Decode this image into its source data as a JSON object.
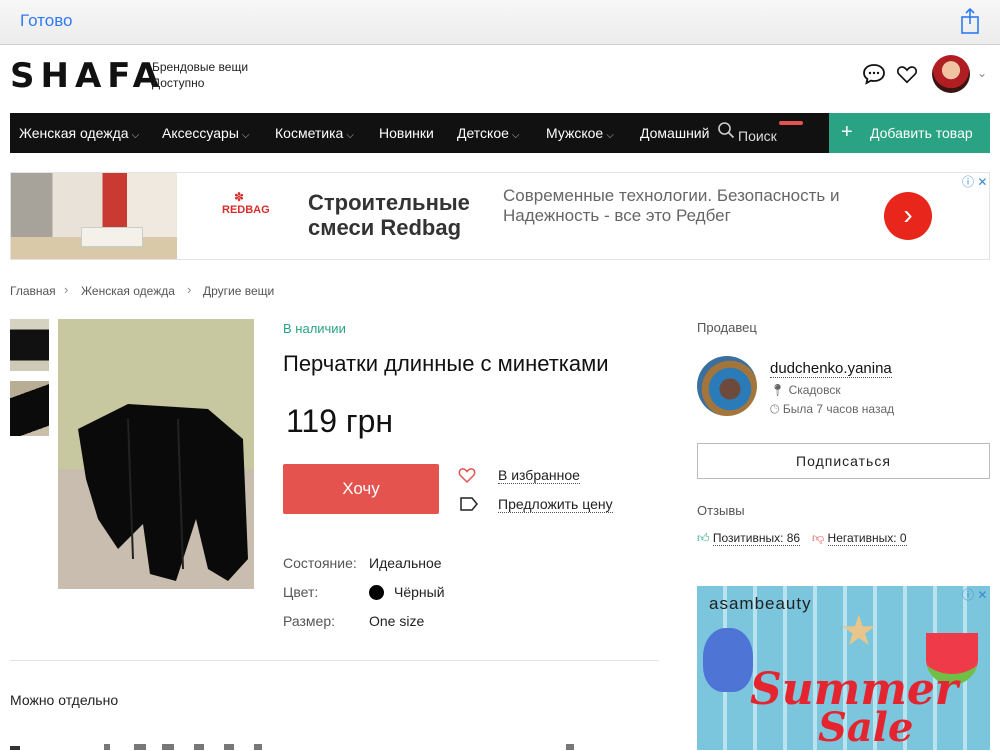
{
  "browser": {
    "done_label": "Готово"
  },
  "header": {
    "logo": "SHAFA",
    "tagline_1": "Брендовые вещи",
    "tagline_2": "Доступно"
  },
  "nav": {
    "items": [
      {
        "label": "Женская одежда",
        "chevron": true
      },
      {
        "label": "Аксессуары",
        "chevron": true
      },
      {
        "label": "Косметика",
        "chevron": true
      },
      {
        "label": "Новинки",
        "chevron": false
      },
      {
        "label": "Детское",
        "chevron": true
      },
      {
        "label": "Мужское",
        "chevron": true
      },
      {
        "label": "Домашний",
        "chevron": false
      }
    ],
    "search_placeholder": "Поиск",
    "add_product": "Добавить товар"
  },
  "ad_banner": {
    "brand": "REDBAG",
    "title": "Строительные смеси Redbag",
    "description": "Современные технологии. Безопасность и Надежность - все это Редбег"
  },
  "breadcrumbs": [
    "Главная",
    "Женская одежда",
    "Другие вещи"
  ],
  "product": {
    "availability": "В наличии",
    "title": "Перчатки длинные с минетками",
    "price": "119 грн",
    "want_button": "Хочу",
    "favorite_link": "В избранное",
    "offer_link": "Предложить цену",
    "attributes": [
      {
        "key": "Состояние:",
        "value": "Идеальное"
      },
      {
        "key": "Цвет:",
        "value": "Чёрный",
        "swatch": "#000000"
      },
      {
        "key": "Размер:",
        "value": "One size"
      }
    ],
    "separately_label": "Можно отдельно"
  },
  "seller": {
    "heading": "Продавец",
    "name": "dudchenko.yanina",
    "location": "Скадовск",
    "last_seen": "Была 7 часов назад",
    "subscribe": "Подписаться",
    "reviews_heading": "Отзывы",
    "positive": "Позитивных: 86",
    "negative": "Негативных: 0"
  },
  "side_ad": {
    "brand": "asambeauty",
    "line1": "Summer",
    "line2": "Sale"
  },
  "colors": {
    "accent_green": "#2aa384",
    "want_red": "#e5534f",
    "safari_blue": "#2f7bf5"
  }
}
